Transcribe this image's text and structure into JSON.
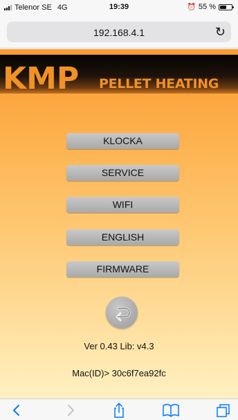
{
  "status_bar": {
    "carrier": "Telenor SE",
    "network": "4G",
    "time": "19:39",
    "battery_percent": "55 %",
    "battery_level": 0.55
  },
  "browser": {
    "url": "192.168.4.1",
    "reload_icon": "reload-icon"
  },
  "logo": {
    "brand": "KMP",
    "company": "PELLET HEATING AB"
  },
  "menu": {
    "buttons": [
      "KLOCKA",
      "SERVICE",
      "WIFI",
      "ENGLISH",
      "FIRMWARE"
    ]
  },
  "back_icon": "back-return-icon",
  "info": {
    "version": "Ver 0.43 Lib: v4.3",
    "mac": "Mac(ID)> 30c6f7ea92fc"
  },
  "toolbar": {
    "icons": [
      "back-chevron-icon",
      "forward-chevron-icon",
      "share-icon",
      "bookmarks-icon",
      "tabs-icon"
    ]
  },
  "colors": {
    "accent": "#007aff",
    "logo_orange": "#f29125",
    "page_top": "#fb9b2d",
    "page_bottom": "#fff0c2",
    "button_gray": "#b5b5b5"
  }
}
